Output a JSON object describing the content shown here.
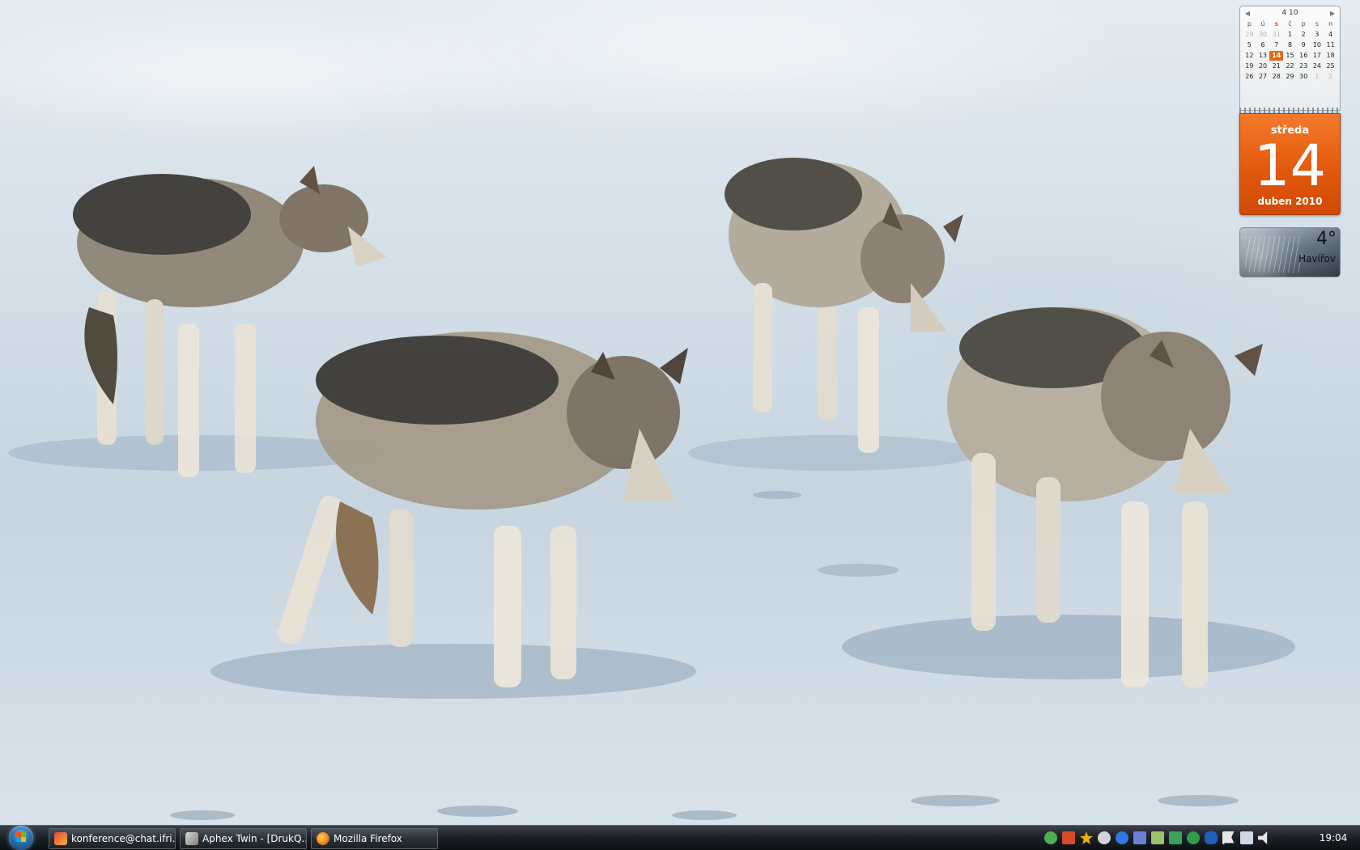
{
  "desktop": {
    "wallpaper": "wolves-on-ice"
  },
  "calendar_gadget": {
    "header": "4 10",
    "weekdays": [
      "p",
      "ú",
      "s",
      "č",
      "p",
      "s",
      "n"
    ],
    "weeks": [
      [
        "29",
        "30",
        "31",
        "1",
        "2",
        "3",
        "4"
      ],
      [
        "5",
        "6",
        "7",
        "8",
        "9",
        "10",
        "11"
      ],
      [
        "12",
        "13",
        "14",
        "15",
        "16",
        "17",
        "18"
      ],
      [
        "19",
        "20",
        "21",
        "22",
        "23",
        "24",
        "25"
      ],
      [
        "26",
        "27",
        "28",
        "29",
        "30",
        "1",
        "2"
      ]
    ],
    "weekday_name": "středa",
    "day": "14",
    "month_year": "duben 2010",
    "accent_color": "#e35a0d"
  },
  "weather_gadget": {
    "temperature": "4°",
    "city": "Havířov"
  },
  "taskbar": {
    "start_icon": "windows-start-orb",
    "buttons": [
      {
        "label": "konference@chat.ifri...",
        "icon": "chat-icon"
      },
      {
        "label": "Aphex Twin - [DrukQ...",
        "icon": "music-player-icon"
      },
      {
        "label": "Mozilla Firefox",
        "icon": "firefox-icon"
      }
    ],
    "tray_icons": [
      "frog-icon",
      "z-icon",
      "star-icon",
      "steam-icon",
      "update-icon",
      "network-icon",
      "store-icon",
      "monitor-icon",
      "check-icon",
      "bluetooth-icon",
      "flag-icon",
      "display-icon",
      "volume-icon"
    ],
    "clock": "19:04"
  }
}
